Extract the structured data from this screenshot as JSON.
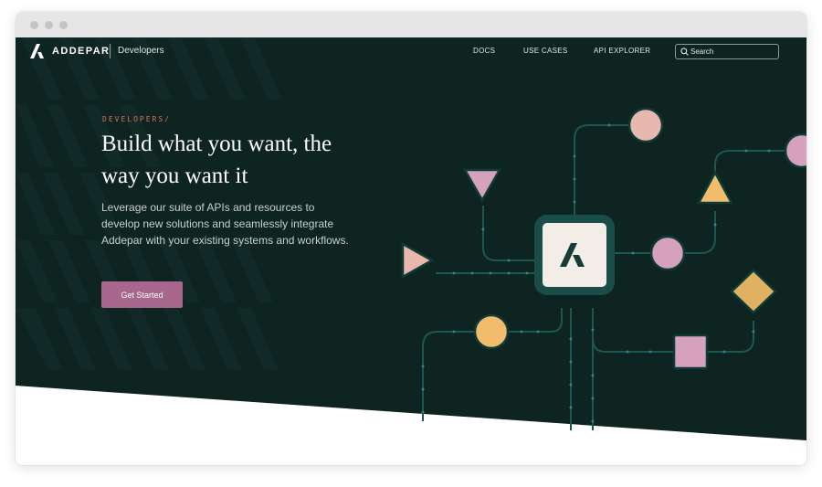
{
  "window": {
    "controls": [
      "window-dot",
      "window-dot",
      "window-dot"
    ]
  },
  "nav": {
    "brand": "ADDEPAR",
    "section": "Developers",
    "links": [
      "DOCS",
      "USE CASES",
      "API EXPLORER"
    ],
    "search_placeholder": "Search",
    "search_value": ""
  },
  "hero": {
    "eyebrow": "DEVELOPERS/",
    "title_line1": "Build what you want, the",
    "title_line2": "way you want it",
    "description": "Leverage our suite of APIs and resources to develop new solutions and seamlessly integrate Addepar with your existing systems and workflows.",
    "cta_label": "Get Started"
  },
  "icons": {
    "logo": "addepar-logo-icon",
    "search": "search-icon",
    "hub": "addepar-logo-icon"
  },
  "colors": {
    "hero_background": "#0d2421",
    "accent_text": "#d8715a",
    "cta_background": "#a8678c",
    "node_peach": "#e8b7ad",
    "node_pink": "#d6a1bc",
    "node_orange": "#f2bc6c",
    "node_gold": "#e0b160",
    "connector": "#1e5651"
  }
}
